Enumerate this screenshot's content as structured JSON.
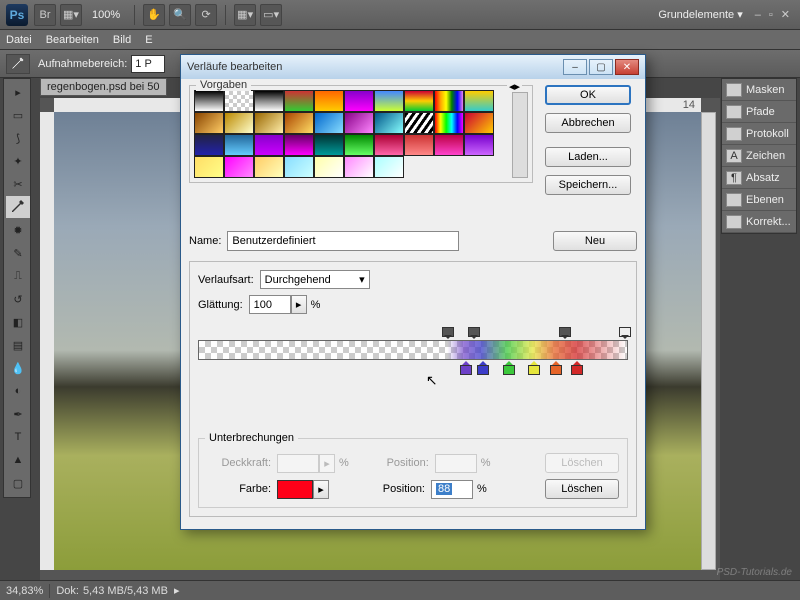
{
  "topbar": {
    "app_abbr": "Ps",
    "br": "Br",
    "zoom": "100%",
    "workspace": "Grundelemente ▾"
  },
  "menu": {
    "file": "Datei",
    "edit": "Bearbeiten",
    "image": "Bild",
    "layer": "E"
  },
  "options": {
    "label": "Aufnahmebereich:",
    "value": "1 P"
  },
  "doc": {
    "tab": "regenbogen.psd bei 50"
  },
  "ruler": {
    "mark14": "14"
  },
  "panels": {
    "masken": "Masken",
    "pfade": "Pfade",
    "protokoll": "Protokoll",
    "zeichen": "Zeichen",
    "absatz": "Absatz",
    "ebenen": "Ebenen",
    "korrekt": "Korrekt..."
  },
  "status": {
    "zoom": "34,83%",
    "doc_label": "Dok:",
    "doc_size": "5,43 MB/5,43 MB"
  },
  "watermark": "PSD-Tutorials.de",
  "dialog": {
    "title": "Verläufe bearbeiten",
    "ok": "OK",
    "cancel": "Abbrechen",
    "load": "Laden...",
    "save": "Speichern...",
    "presets": "Vorgaben",
    "name_label": "Name:",
    "name_value": "Benutzerdefiniert",
    "new": "Neu",
    "grad_type_label": "Verlaufsart:",
    "grad_type_value": "Durchgehend",
    "smooth_label": "Glättung:",
    "smooth_value": "100",
    "pct": "%",
    "stops": {
      "opacity": [
        58,
        64,
        85,
        99
      ],
      "colors": [
        {
          "pos": 62,
          "c": "#6d41c8"
        },
        {
          "pos": 66,
          "c": "#3c3cc8"
        },
        {
          "pos": 72,
          "c": "#3cc83c"
        },
        {
          "pos": 78,
          "c": "#e6e63c"
        },
        {
          "pos": 83,
          "c": "#e66428"
        },
        {
          "pos": 88,
          "c": "#d22828"
        }
      ]
    },
    "interrupt": {
      "legend": "Unterbrechungen",
      "opacity_label": "Deckkraft:",
      "position_label": "Position:",
      "color_label": "Farbe:",
      "pos_value": "88",
      "pct": "%",
      "delete": "Löschen"
    }
  }
}
